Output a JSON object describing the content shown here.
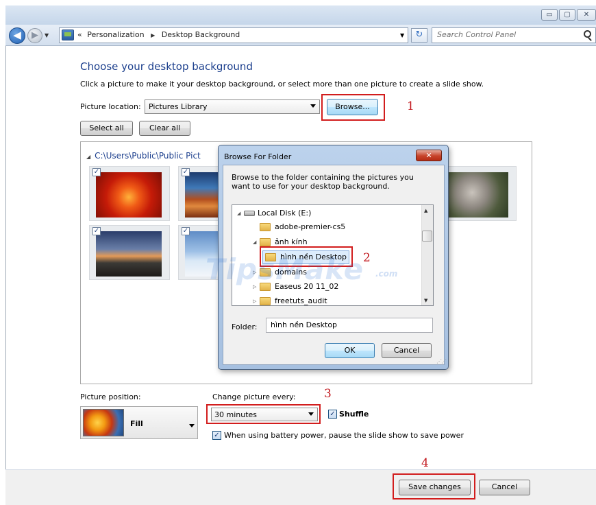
{
  "window": {
    "caption_buttons": [
      "▭",
      "▢",
      "✕"
    ],
    "breadcrumb": [
      "«",
      "Personalization",
      "Desktop Background"
    ],
    "search_placeholder": "Search Control Panel"
  },
  "main": {
    "title": "Choose your desktop background",
    "instructions": "Click a picture to make it your desktop background, or select more than one picture to create a slide show.",
    "picture_location_label": "Picture location:",
    "picture_location_value": "Pictures Library",
    "browse_label": "Browse...",
    "select_all_label": "Select all",
    "clear_all_label": "Clear all",
    "folder_path": "C:\\Users\\Public\\Public Pict",
    "picture_position_label": "Picture position:",
    "picture_position_value": "Fill",
    "change_picture_label": "Change picture every:",
    "change_picture_value": "30 minutes",
    "shuffle_label": "Shuffle",
    "battery_label": "When using battery power, pause the slide show to save power",
    "save_label": "Save changes",
    "cancel_label": "Cancel"
  },
  "thumbnails": [
    {
      "name": "flower",
      "checked": true
    },
    {
      "name": "desert",
      "checked": true
    },
    {
      "name": "lighthouse",
      "checked": true
    },
    {
      "name": "penguins",
      "checked": true
    },
    {
      "name": "koala",
      "checked": true
    }
  ],
  "dialog": {
    "title": "Browse For Folder",
    "close_glyph": "✕",
    "description": "Browse to the folder containing the pictures you want to use for your desktop background.",
    "tree": [
      {
        "label": "Local Disk (E:)",
        "type": "drive",
        "expander": "◢"
      },
      {
        "label": "adobe-premier-cs5",
        "type": "folder",
        "expander": ""
      },
      {
        "label": "ảnh kính",
        "type": "folder",
        "expander": "◢"
      },
      {
        "label": "hình nền Desktop",
        "type": "folder",
        "expander": "",
        "selected": true
      },
      {
        "label": "domains",
        "type": "folder",
        "expander": "▷"
      },
      {
        "label": "Easeus 20 11_02",
        "type": "folder",
        "expander": "▷"
      },
      {
        "label": "freetuts_audit",
        "type": "folder",
        "expander": "▷"
      }
    ],
    "folder_label": "Folder:",
    "folder_value": "hình nền Desktop",
    "ok_label": "OK",
    "cancel_label": "Cancel"
  },
  "annotations": [
    "1",
    "2",
    "3",
    "4"
  ],
  "watermark": {
    "text": "TipsMake",
    "suffix": ".com"
  },
  "colors": {
    "title_blue": "#1c3f8d",
    "annotation_red": "#d21d1d",
    "dialog_frame": "#a6c0e0"
  }
}
